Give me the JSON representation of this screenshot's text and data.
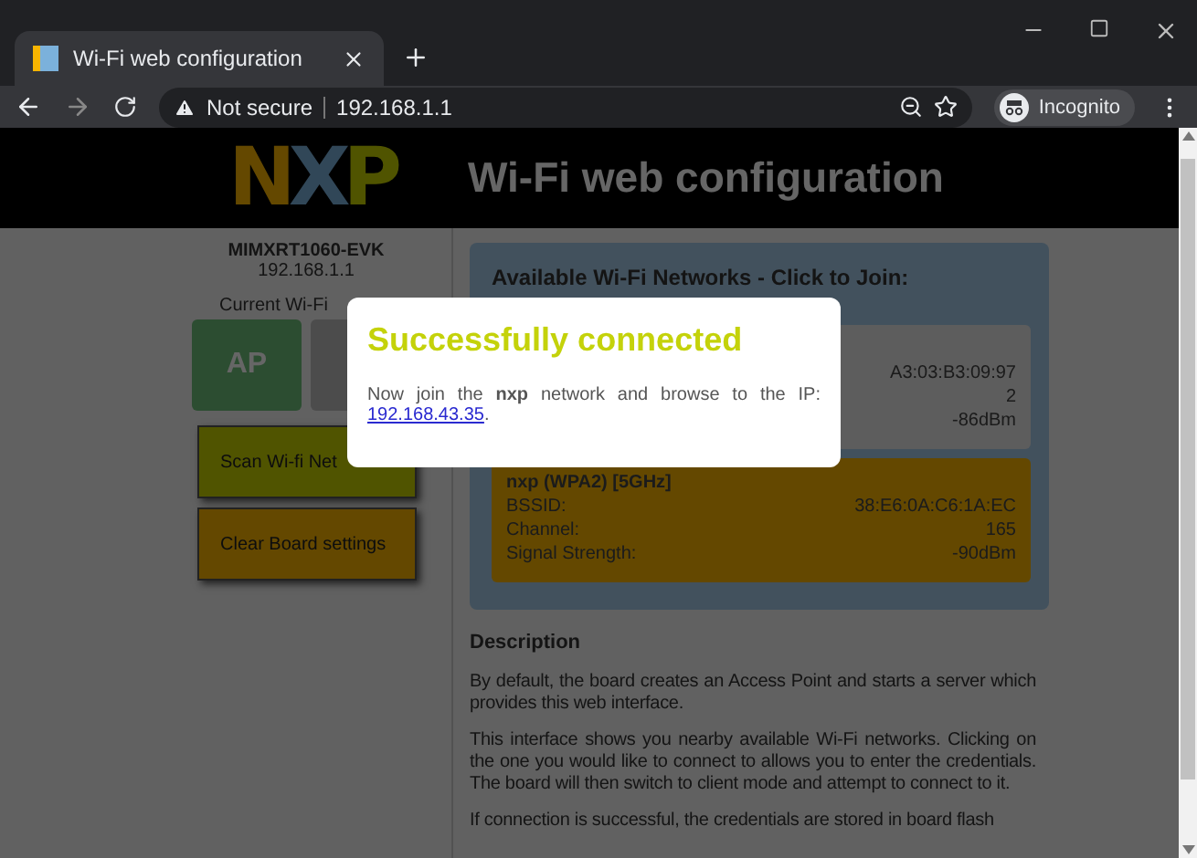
{
  "browser": {
    "tab_title": "Wi-Fi web configuration",
    "security": "Not secure",
    "url": "192.168.1.1",
    "profile": "Incognito"
  },
  "header": {
    "logo": "NXP",
    "title": "Wi-Fi web configuration"
  },
  "sidebar": {
    "device": "MIMXRT1060-EVK",
    "ip": "192.168.1.1",
    "current_label": "Current Wi-Fi",
    "modes": [
      {
        "label": "AP",
        "selected": true
      },
      {
        "selected": false
      }
    ],
    "buttons": [
      {
        "label": "Scan Wi-fi Net",
        "kind": "scan"
      },
      {
        "label": "Clear Board settings",
        "kind": "clear"
      }
    ]
  },
  "networks_panel": {
    "title": "Available Wi-Fi Networks - Click to Join:",
    "networks": [
      {
        "selected": false,
        "rows": [
          {
            "value": "A3:03:B3:09:97"
          },
          {
            "value": "2"
          },
          {
            "value": "-86dBm"
          }
        ]
      },
      {
        "selected": true,
        "name": "nxp (WPA2) [5GHz]",
        "rows": [
          {
            "label": "BSSID:",
            "value": "38:E6:0A:C6:1A:EC"
          },
          {
            "label": "Channel:",
            "value": "165"
          },
          {
            "label": "Signal Strength:",
            "value": "-90dBm"
          }
        ]
      }
    ]
  },
  "description": {
    "title": "Description",
    "paragraphs": [
      "By default, the board creates an Access Point and starts a server which provides this web interface.",
      "This interface shows you nearby available Wi-Fi networks. Clicking on the one you would like to connect to allows you to enter the credentials. The board will then switch to client mode and attempt to connect to it.",
      "If connection is successful, the credentials are stored in board flash"
    ]
  },
  "dialog": {
    "title": "Successfully connected",
    "message": "Now join the **nxp** network and browse to the IP:",
    "link": "192.168.43.35",
    "after_link": "."
  }
}
